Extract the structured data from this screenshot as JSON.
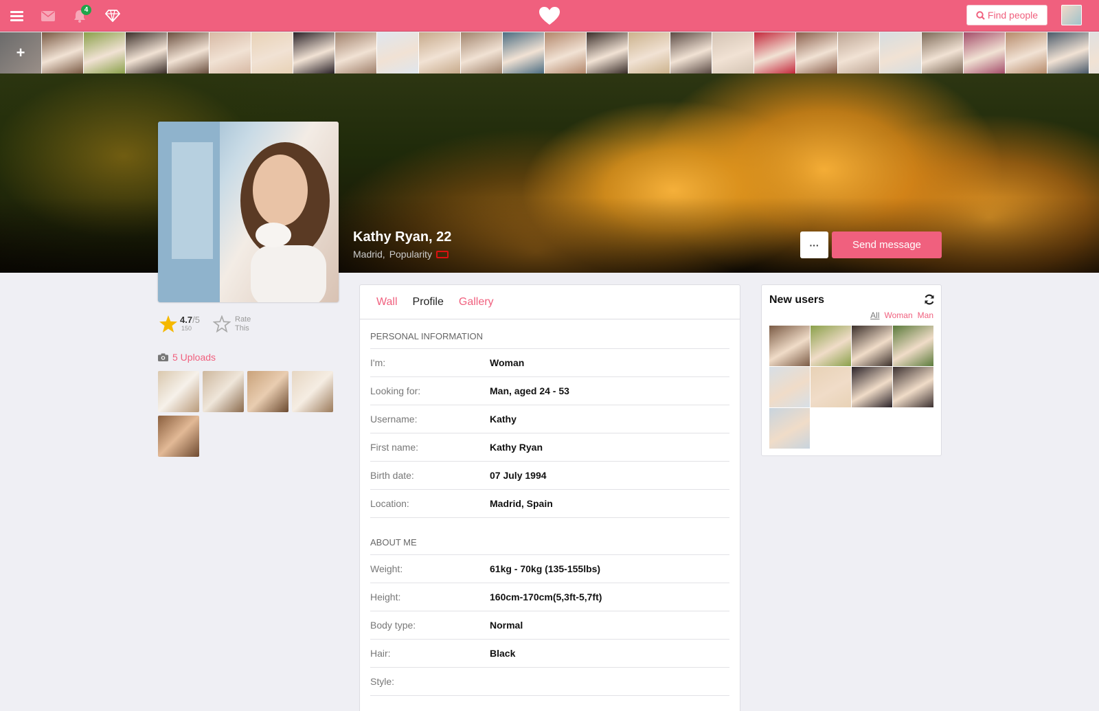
{
  "topbar": {
    "notification_count": "4",
    "find_people_label": "Find people",
    "brand_color": "#f0607e",
    "icons": [
      "menu-icon",
      "mail-icon",
      "bell-icon",
      "diamond-icon",
      "heart-logo-icon",
      "search-icon"
    ]
  },
  "strip": {
    "add_label": "+",
    "photo_count": 26
  },
  "profile": {
    "name": "Kathy Ryan, 22",
    "city": "Madrid,",
    "popularity_label": "Popularity",
    "more_label": "···",
    "send_message_label": "Send message",
    "rating_value": "4.7",
    "rating_max": "/5",
    "rating_count": "150",
    "rate_this_line1": "Rate",
    "rate_this_line2": "This",
    "uploads_label": "5 Uploads"
  },
  "tabs": [
    {
      "label": "Wall",
      "active": false
    },
    {
      "label": "Profile",
      "active": true
    },
    {
      "label": "Gallery",
      "active": false
    }
  ],
  "personal": {
    "heading": "PERSONAL INFORMATION",
    "rows": [
      {
        "key": "I'm:",
        "value": "Woman"
      },
      {
        "key": "Looking for:",
        "value": "Man, aged 24 - 53"
      },
      {
        "key": "Username:",
        "value": "Kathy"
      },
      {
        "key": "First name:",
        "value": "Kathy Ryan"
      },
      {
        "key": "Birth date:",
        "value": "07 July 1994"
      },
      {
        "key": "Location:",
        "value": "Madrid, Spain"
      }
    ]
  },
  "about": {
    "heading": "ABOUT ME",
    "rows": [
      {
        "key": "Weight:",
        "value": "61kg - 70kg (135-155lbs)"
      },
      {
        "key": "Height:",
        "value": "160cm-170cm(5,3ft-5,7ft)"
      },
      {
        "key": "Body type:",
        "value": "Normal"
      },
      {
        "key": "Hair:",
        "value": "Black"
      },
      {
        "key": "Style:",
        "value": ""
      }
    ]
  },
  "new_users": {
    "title": "New users",
    "filters": [
      {
        "label": "All",
        "active": true
      },
      {
        "label": "Woman",
        "active": false
      },
      {
        "label": "Man",
        "active": false
      }
    ],
    "count": 9
  }
}
